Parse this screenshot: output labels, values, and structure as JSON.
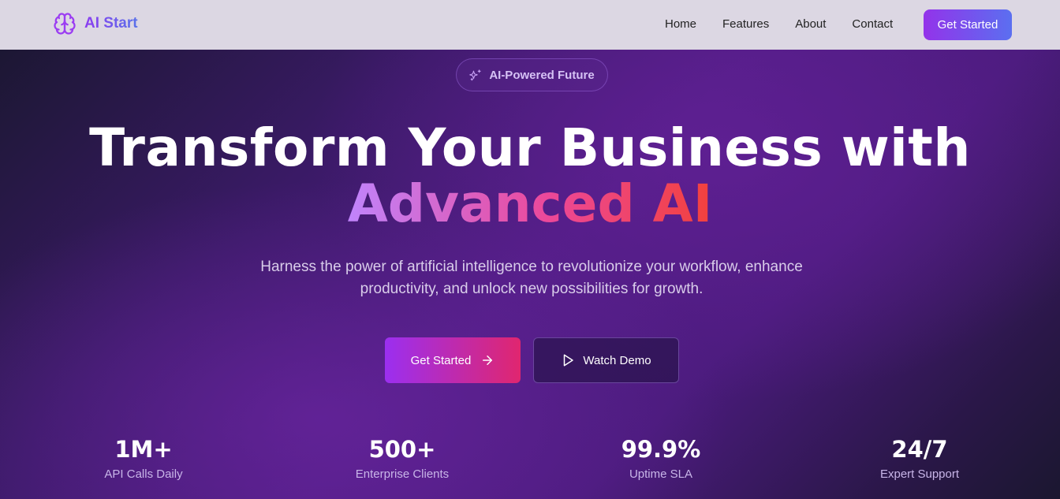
{
  "nav": {
    "brand": "AI Start",
    "brand_icon": "brain-icon",
    "links": [
      "Home",
      "Features",
      "About",
      "Contact"
    ],
    "cta_label": "Get Started"
  },
  "hero": {
    "badge": {
      "icon": "sparkles-icon",
      "label": "AI-Powered Future"
    },
    "headline_line1": "Transform Your Business with",
    "headline_line2": "Advanced AI",
    "subtitle": "Harness the power of artificial intelligence to revolutionize your workflow, enhance productivity, and unlock new possibilities for growth.",
    "primary_button": {
      "label": "Get Started",
      "icon": "arrow-right-icon"
    },
    "secondary_button": {
      "label": "Watch Demo",
      "icon": "play-icon"
    }
  },
  "stats": [
    {
      "value": "1M+",
      "label": "API Calls Daily"
    },
    {
      "value": "500+",
      "label": "Enterprise Clients"
    },
    {
      "value": "99.9%",
      "label": "Uptime SLA"
    },
    {
      "value": "24/7",
      "label": "Expert Support"
    }
  ],
  "colors": {
    "brand_gradient": [
      "#8b3cf0",
      "#5a72ea"
    ],
    "primary_button_gradient": [
      "#9b2ff0",
      "#e0266f"
    ],
    "headline_accent_gradient": [
      "#c084fc",
      "#ec4899",
      "#f2413d"
    ],
    "hero_background": "#4f1d83"
  }
}
